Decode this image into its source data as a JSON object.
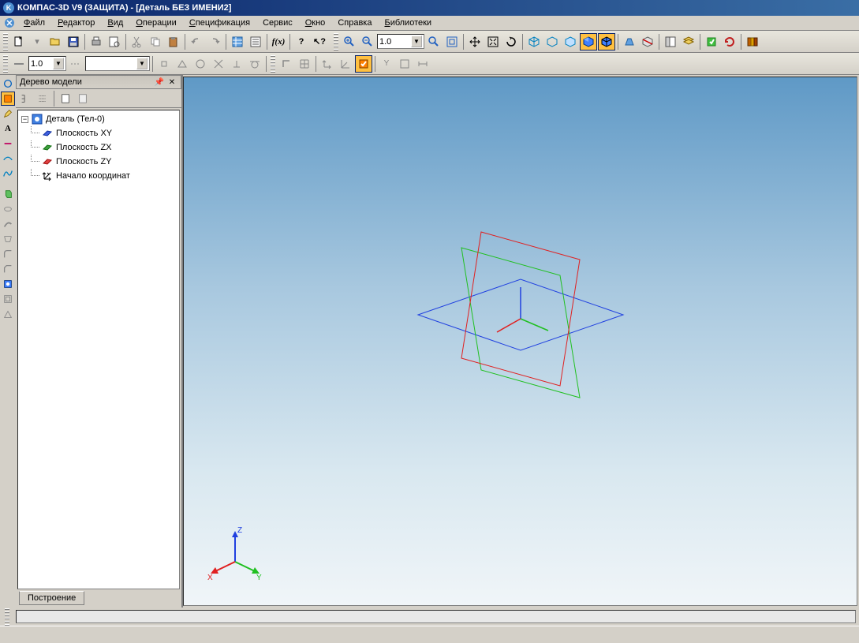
{
  "title": "КОМПАС-3D V9 (ЗАЩИТА) - [Деталь БЕЗ ИМЕНИ2]",
  "menu": {
    "file": "Файл",
    "editor": "Редактор",
    "view": "Вид",
    "operations": "Операции",
    "spec": "Спецификация",
    "service": "Сервис",
    "window": "Окно",
    "help": "Справка",
    "libraries": "Библиотеки"
  },
  "toolbar1": {
    "combo1_value": "1.0",
    "combo2_value": "1.0"
  },
  "toolbar2": {
    "combo_width": "1.0",
    "combo_long": ""
  },
  "tree": {
    "panel_title": "Дерево модели",
    "root": "Деталь (Тел-0)",
    "items": [
      {
        "label": "Плоскость XY",
        "color": "#2040c0"
      },
      {
        "label": "Плоскость ZX",
        "color": "#208020"
      },
      {
        "label": "Плоскость ZY",
        "color": "#c02020"
      },
      {
        "label": "Начало координат",
        "color": "#000"
      }
    ],
    "tab": "Построение"
  },
  "axis_labels": {
    "x": "X",
    "y": "Y",
    "z": "Z"
  }
}
